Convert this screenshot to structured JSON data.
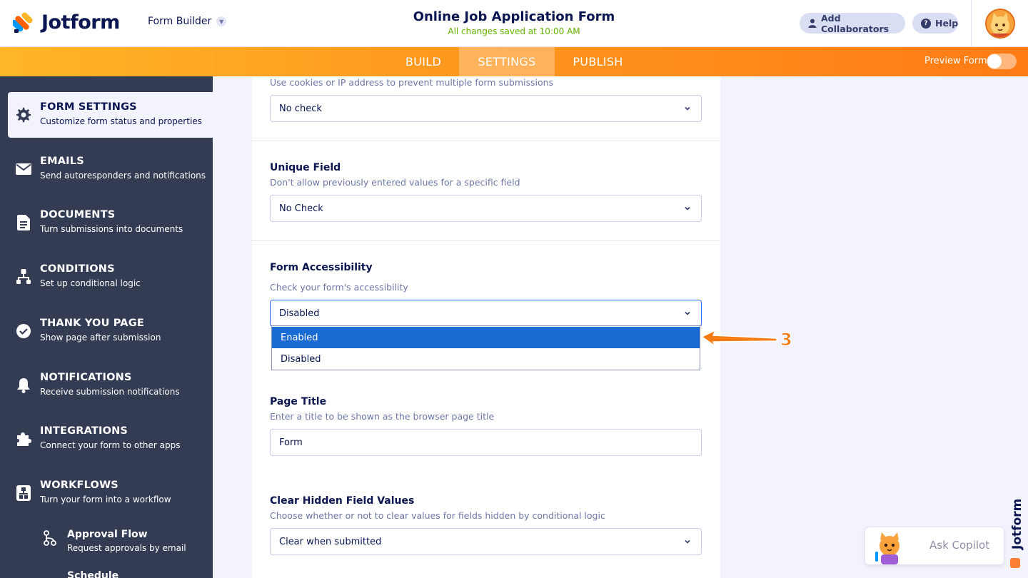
{
  "header": {
    "logo_text": "Jotform",
    "form_builder_label": "Form Builder",
    "form_title": "Online Job Application Form",
    "save_status": "All changes saved at 10:00 AM",
    "add_collaborators_label": "Add Collaborators",
    "help_label": "Help"
  },
  "nav": {
    "tabs": [
      {
        "label": "BUILD"
      },
      {
        "label": "SETTINGS",
        "active": true
      },
      {
        "label": "PUBLISH"
      }
    ],
    "preview_label": "Preview Form"
  },
  "sidebar": {
    "items": [
      {
        "title": "FORM SETTINGS",
        "subtitle": "Customize form status and properties",
        "icon": "gear-icon",
        "active": true
      },
      {
        "title": "EMAILS",
        "subtitle": "Send autoresponders and notifications",
        "icon": "envelope-icon"
      },
      {
        "title": "DOCUMENTS",
        "subtitle": "Turn submissions into documents",
        "icon": "document-icon"
      },
      {
        "title": "CONDITIONS",
        "subtitle": "Set up conditional logic",
        "icon": "conditions-icon"
      },
      {
        "title": "THANK YOU PAGE",
        "subtitle": "Show page after submission",
        "icon": "check-circle-icon"
      },
      {
        "title": "NOTIFICATIONS",
        "subtitle": "Receive submission notifications",
        "icon": "bell-icon"
      },
      {
        "title": "INTEGRATIONS",
        "subtitle": "Connect your form to other apps",
        "icon": "puzzle-icon"
      },
      {
        "title": "WORKFLOWS",
        "subtitle": "Turn your form into a workflow",
        "icon": "workflow-icon"
      }
    ],
    "sub_items": [
      {
        "title": "Approval Flow",
        "subtitle": "Request approvals by email",
        "icon": "approval-flow-icon"
      },
      {
        "title": "Schedule",
        "subtitle": ""
      }
    ]
  },
  "settings": {
    "cookies": {
      "description": "Use cookies or IP address to prevent multiple form submissions",
      "value": "No check"
    },
    "unique_field": {
      "label": "Unique Field",
      "description": "Don't allow previously entered values for a specific field",
      "value": "No Check"
    },
    "accessibility": {
      "label": "Form Accessibility",
      "description": "Check your form's accessibility",
      "value": "Disabled",
      "options": [
        "Enabled",
        "Disabled"
      ],
      "highlighted_option": "Enabled"
    },
    "page_title": {
      "label": "Page Title",
      "description": "Enter a title to be shown as the browser page title",
      "value": "Form"
    },
    "clear_hidden": {
      "label": "Clear Hidden Field Values",
      "description": "Choose whether or not to clear values for fields hidden by conditional logic",
      "value": "Clear when submitted"
    }
  },
  "annotation": {
    "step_number": "3",
    "color": "#f57c14"
  },
  "copilot": {
    "label": "Ask Copilot"
  },
  "brand_vertical": {
    "text": "Jotform"
  },
  "colors": {
    "accent_orange": "#ff7b14",
    "sidebar_bg": "#343c54",
    "navy": "#0a1551",
    "highlight_blue": "#1a6ad3",
    "saved_green": "#64b200"
  }
}
